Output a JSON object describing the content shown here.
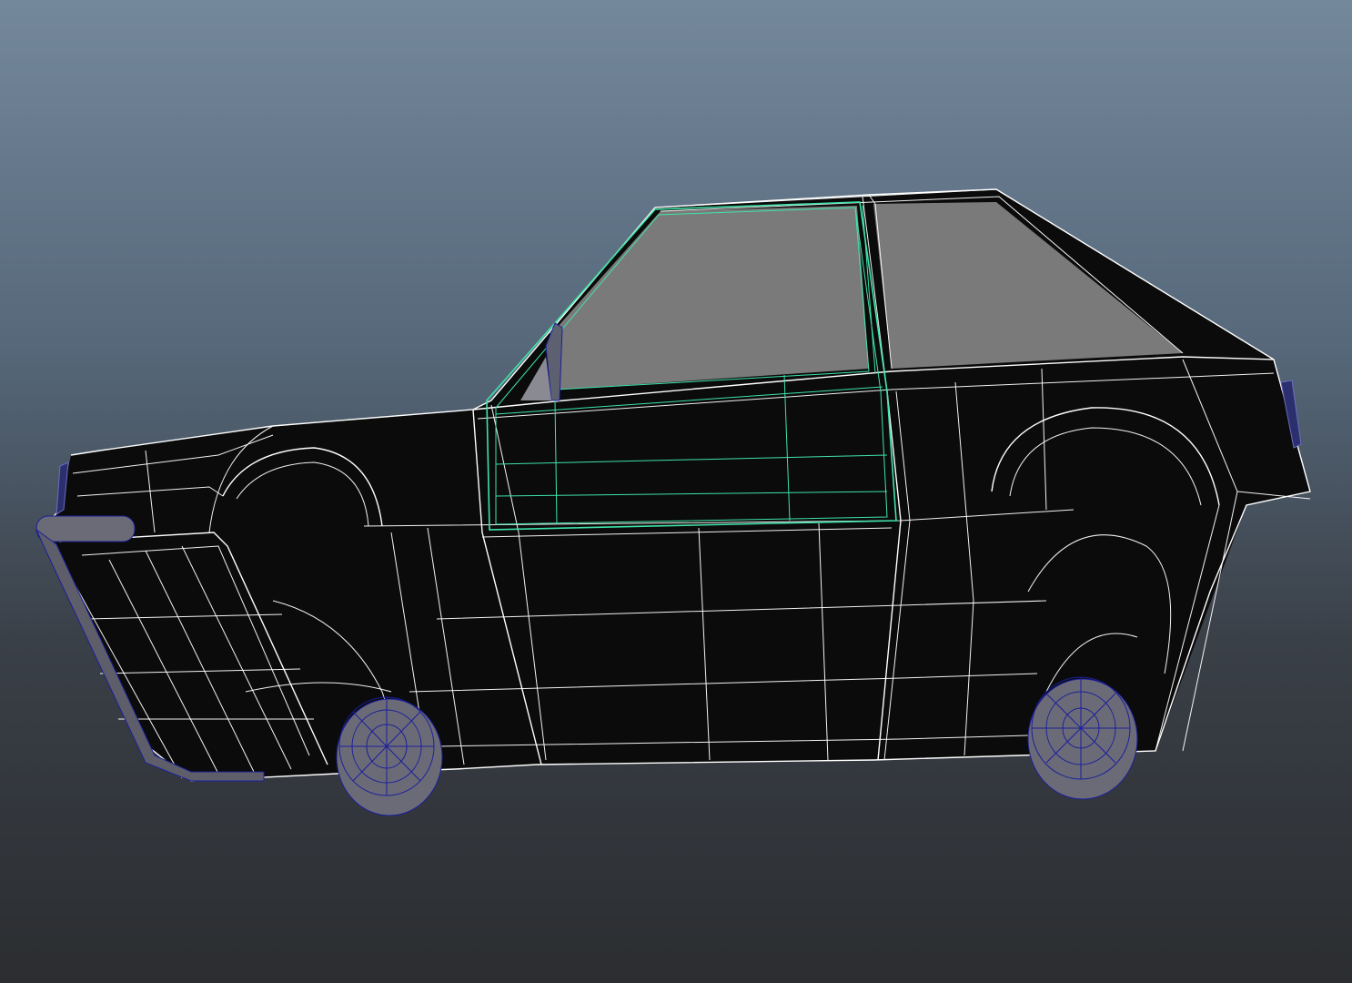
{
  "viewport": {
    "background_top": "#74889c",
    "background_bottom": "#2b2d30",
    "wireframe_color": "#ffffff",
    "selection_color": "#3fe3a8",
    "tire_wire_color": "#1c1f9a",
    "body_shade": "#0b0b0b",
    "glass_shade": "#7a7a7a"
  }
}
